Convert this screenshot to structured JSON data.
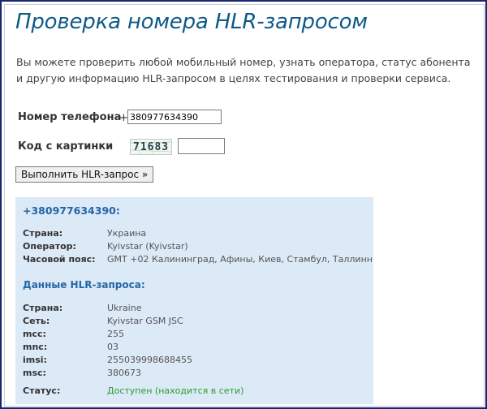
{
  "page": {
    "title": "Проверка номера HLR-запросом",
    "intro": "Вы можете проверить любой мобильный номер, узнать оператора, статус абонента и другую информацию HLR-запросом в целях тестирования и проверки сервиса."
  },
  "form": {
    "phone_label": "Номер телефона",
    "phone_prefix": "+",
    "phone_value": "380977634390",
    "captcha_label": "Код с картинки",
    "captcha_code": "71683",
    "captcha_value": "",
    "submit_label": "Выполнить HLR-запрос »"
  },
  "result": {
    "number": "+380977634390:",
    "country_label": "Страна:",
    "country_value": "Украина",
    "operator_label": "Оператор:",
    "operator_value": "Kyivstar (Kyivstar)",
    "tz_label": "Часовой пояс:",
    "tz_value": "GMT +02 Калининград, Афины, Киев, Стамбул, Таллинн",
    "hlr_title": "Данные HLR-запроса:",
    "hlr": {
      "country_label": "Страна:",
      "country_value": "Ukraine",
      "network_label": "Сеть:",
      "network_value": "Kyivstar GSM JSC",
      "mcc_label": "mcc:",
      "mcc_value": "255",
      "mnc_label": "mnc:",
      "mnc_value": "03",
      "imsi_label": "imsi:",
      "imsi_value": "255039998688455",
      "msc_label": "msc:",
      "msc_value": "380673",
      "status_label": "Статус:",
      "status_value": "Доступен (находится в сети)"
    }
  },
  "colors": {
    "title": "#0f5a87",
    "result_bg": "#dce9f7",
    "link_blue": "#2466a5",
    "status_ok": "#2c9c2c",
    "frame": "#16256f"
  }
}
